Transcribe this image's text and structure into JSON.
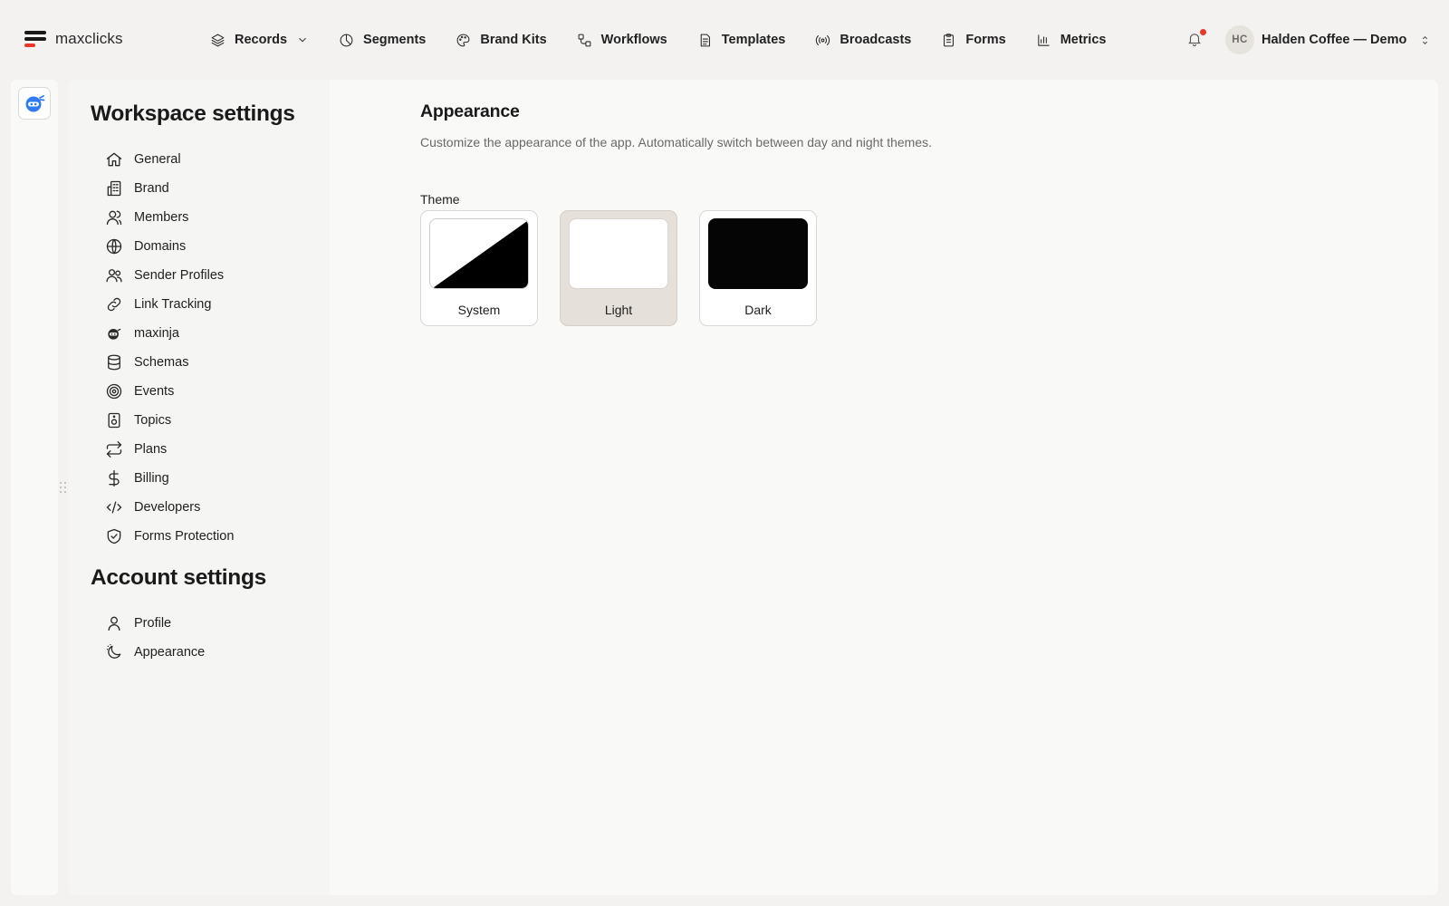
{
  "app": {
    "logo_text": "maxclicks"
  },
  "nav": {
    "items": [
      {
        "label": "Records",
        "icon": "layers-icon",
        "has_dropdown": true
      },
      {
        "label": "Segments",
        "icon": "pie-icon"
      },
      {
        "label": "Brand Kits",
        "icon": "palette-icon"
      },
      {
        "label": "Workflows",
        "icon": "workflow-icon"
      },
      {
        "label": "Templates",
        "icon": "document-icon"
      },
      {
        "label": "Broadcasts",
        "icon": "broadcast-icon"
      },
      {
        "label": "Forms",
        "icon": "clipboard-icon"
      },
      {
        "label": "Metrics",
        "icon": "bar-chart-icon"
      }
    ]
  },
  "account": {
    "initials": "HC",
    "name": "Halden Coffee — Demo"
  },
  "sidebar": {
    "workspace_title": "Workspace settings",
    "workspace_items": [
      {
        "label": "General",
        "icon": "home-icon"
      },
      {
        "label": "Brand",
        "icon": "building-icon"
      },
      {
        "label": "Members",
        "icon": "user-icon"
      },
      {
        "label": "Domains",
        "icon": "globe-icon"
      },
      {
        "label": "Sender Profiles",
        "icon": "users-icon"
      },
      {
        "label": "Link Tracking",
        "icon": "link-icon"
      },
      {
        "label": "maxinja",
        "icon": "ninja-icon"
      },
      {
        "label": "Schemas",
        "icon": "database-icon"
      },
      {
        "label": "Events",
        "icon": "target-icon"
      },
      {
        "label": "Topics",
        "icon": "speaker-icon"
      },
      {
        "label": "Plans",
        "icon": "repeat-icon"
      },
      {
        "label": "Billing",
        "icon": "dollar-icon"
      },
      {
        "label": "Developers",
        "icon": "code-icon"
      },
      {
        "label": "Forms Protection",
        "icon": "shield-check-icon"
      }
    ],
    "account_title": "Account settings",
    "account_items": [
      {
        "label": "Profile",
        "icon": "user-icon"
      },
      {
        "label": "Appearance",
        "icon": "moon-stars-icon"
      }
    ]
  },
  "main": {
    "title": "Appearance",
    "description": "Customize the appearance of the app. Automatically switch between day and night themes.",
    "theme_label": "Theme",
    "themes": [
      {
        "label": "System",
        "selected": false
      },
      {
        "label": "Light",
        "selected": true
      },
      {
        "label": "Dark",
        "selected": false
      }
    ]
  },
  "colors": {
    "accent": "#e8372a",
    "selected_card": "#e5e0d9",
    "rail_icon": "#2f7bf5"
  }
}
